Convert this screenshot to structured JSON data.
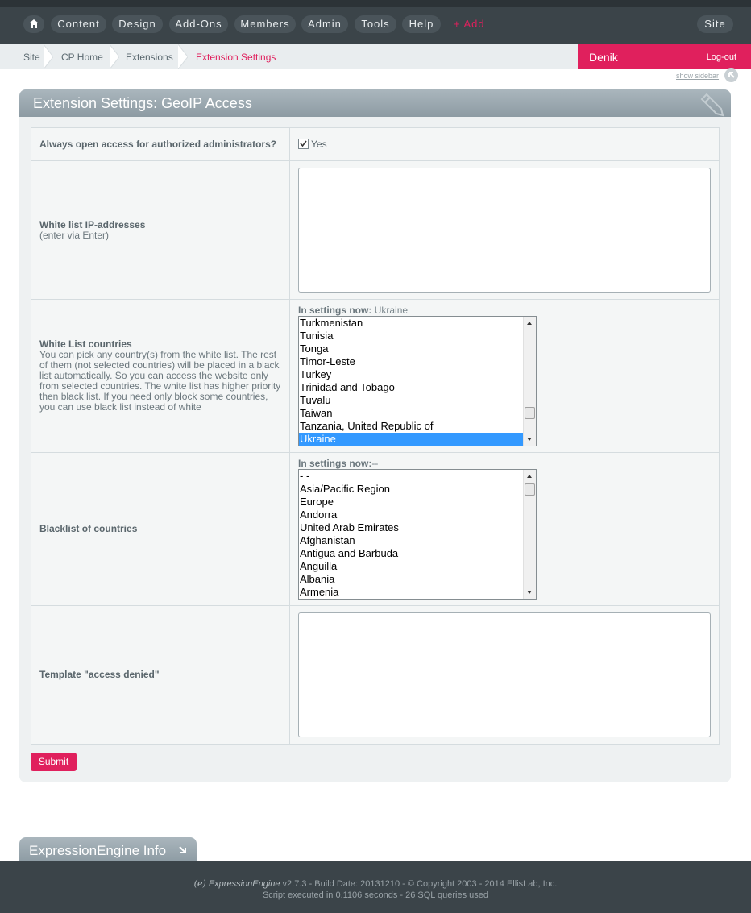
{
  "nav": {
    "items": [
      "Content",
      "Design",
      "Add-Ons",
      "Members",
      "Admin",
      "Tools",
      "Help"
    ],
    "add_label": "+ Add",
    "site_label": "Site"
  },
  "breadcrumb": [
    "Site",
    "CP Home",
    "Extensions",
    "Extension Settings"
  ],
  "user": {
    "name": "Denik",
    "logout_label": "Log-out"
  },
  "show_sidebar_label": "show sidebar",
  "panel": {
    "title": "Extension Settings: GeoIP Access",
    "rows": {
      "admins": {
        "label": "Always open access for authorized administrators?",
        "checkbox_label": "Yes",
        "checked": true
      },
      "whitelist_ip": {
        "label": "White list IP-addresses",
        "hint": "(enter via Enter)",
        "value": ""
      },
      "whitelist_countries": {
        "label": "White List countries",
        "hint": "You can pick any country(s) from the white list. The rest of them (not selected countries) will be placed in a black list automatically. So you can access the website only from selected countries. The white list has higher priority then black list. If you need only block some countries, you can use black list instead of white",
        "now_label": "In settings now:",
        "now_value": "Ukraine",
        "options": [
          "Turkmenistan",
          "Tunisia",
          "Tonga",
          "Timor-Leste",
          "Turkey",
          "Trinidad and Tobago",
          "Tuvalu",
          "Taiwan",
          "Tanzania, United Republic of",
          "Ukraine"
        ],
        "selected": "Ukraine"
      },
      "blacklist_countries": {
        "label": "Blacklist of countries",
        "now_label": "In settings now:",
        "now_value": "--",
        "options": [
          "- -",
          "Asia/Pacific Region",
          "Europe",
          "Andorra",
          "United Arab Emirates",
          "Afghanistan",
          "Antigua and Barbuda",
          "Anguilla",
          "Albania",
          "Armenia"
        ]
      },
      "template": {
        "label": "Template \"access denied\"",
        "value": ""
      }
    },
    "submit_label": "Submit"
  },
  "footer": {
    "info_tab": "ExpressionEngine Info",
    "brand": "ExpressionEngine",
    "version_line": " v2.7.3 - Build Date: 20131210 - © Copyright 2003 - 2014 EllisLab, Inc.",
    "stats_line": "Script executed in 0.1106 seconds - 26 SQL queries used"
  },
  "colors": {
    "accent": "#e0205d",
    "navbar": "#3b4449",
    "panel_bg": "#eef1f2"
  }
}
